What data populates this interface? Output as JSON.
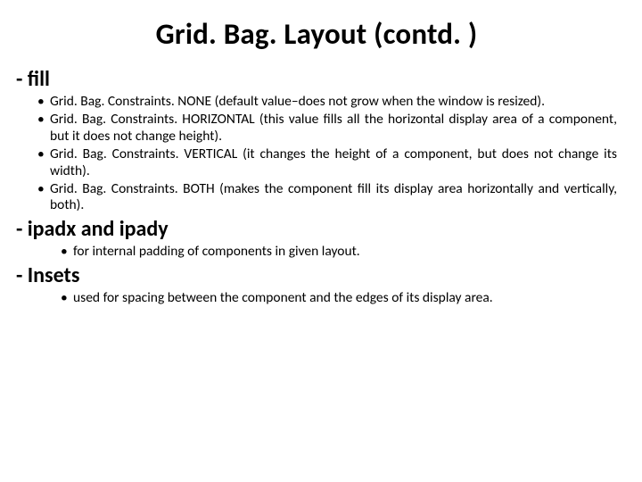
{
  "title": "Grid. Bag. Layout (contd. )",
  "sections": [
    {
      "head": "- fill",
      "indent": false,
      "items": [
        "Grid. Bag. Constraints. NONE (default value–does not grow when the window is resized).",
        "Grid. Bag. Constraints. HORIZONTAL (this value fills all the horizontal display area of a component, but it does not change height).",
        "Grid. Bag. Constraints. VERTICAL (it changes the height of a component, but does not change its width).",
        "Grid. Bag. Constraints. BOTH (makes the component fill its display area horizontally and vertically, both)."
      ]
    },
    {
      "head": "- ipadx and ipady",
      "indent": true,
      "items": [
        "for internal padding of components in given layout."
      ]
    },
    {
      "head": "- Insets",
      "indent": true,
      "items": [
        "used for spacing between the component and the edges of its display area."
      ]
    }
  ]
}
